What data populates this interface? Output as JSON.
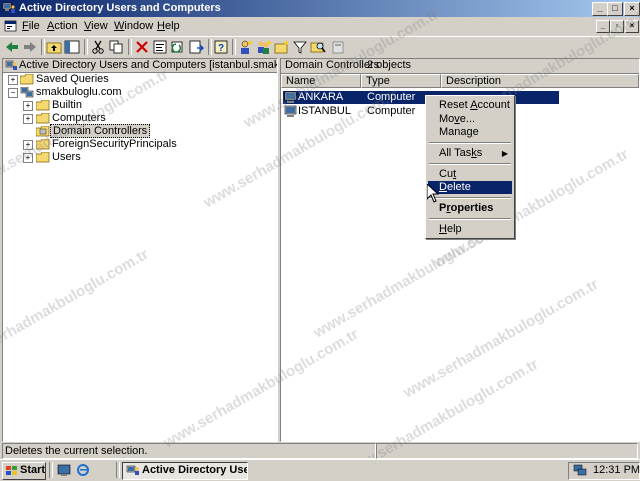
{
  "window": {
    "title": "Active Directory Users and Computers"
  },
  "menu": {
    "items": [
      {
        "label": "File",
        "accel": "F",
        "rest": "ile"
      },
      {
        "label": "Action",
        "accel": "A",
        "rest": "ction"
      },
      {
        "label": "View",
        "accel": "V",
        "rest": "iew"
      },
      {
        "label": "Window",
        "accel": "W",
        "rest": "indow"
      },
      {
        "label": "Help",
        "accel": "H",
        "rest": "elp"
      }
    ]
  },
  "tree": {
    "root": "Active Directory Users and Computers [istanbul.smakbuloglu.com]",
    "saved_queries": "Saved Queries",
    "domain": "smakbuloglu.com",
    "children": [
      "Builtin",
      "Computers",
      "Domain Controllers",
      "ForeignSecurityPrincipals",
      "Users"
    ]
  },
  "detail": {
    "header_title": "Domain Controllers",
    "header_count": "2 objects",
    "columns": [
      "Name",
      "Type",
      "Description"
    ],
    "rows": [
      {
        "name": "ANKARA",
        "type": "Computer",
        "description": ""
      },
      {
        "name": "ISTANBUL",
        "type": "Computer",
        "description": ""
      }
    ]
  },
  "context_menu": {
    "items": [
      {
        "label": "Reset Account",
        "pre": "Reset ",
        "accel": "A",
        "post": "ccount"
      },
      {
        "label": "Move...",
        "pre": "Mo",
        "accel": "v",
        "post": "e..."
      },
      {
        "label": "Manage",
        "pre": "Mana",
        "accel": "g",
        "post": "e"
      },
      {
        "label": "All Tasks",
        "pre": "All Tas",
        "accel": "k",
        "post": "s"
      },
      {
        "label": "Cut",
        "pre": "Cu",
        "accel": "t",
        "post": ""
      },
      {
        "label": "Delete",
        "pre": "",
        "accel": "D",
        "post": "elete"
      },
      {
        "label": "Properties",
        "pre": "P",
        "accel": "r",
        "post": "operties"
      },
      {
        "label": "Help",
        "pre": "",
        "accel": "H",
        "post": "elp"
      }
    ],
    "highlighted": "Delete"
  },
  "status": {
    "text": "Deletes the current selection."
  },
  "taskbar": {
    "start_label": "Start",
    "task_label": "Active Directory User...",
    "clock": "12:31 PM"
  },
  "watermark": "www.serhadmakbuloglu.com.tr",
  "colors": {
    "title_start": "#0a246a",
    "title_end": "#a6caf0",
    "selection": "#0a246a",
    "face": "#d4d0c8"
  }
}
